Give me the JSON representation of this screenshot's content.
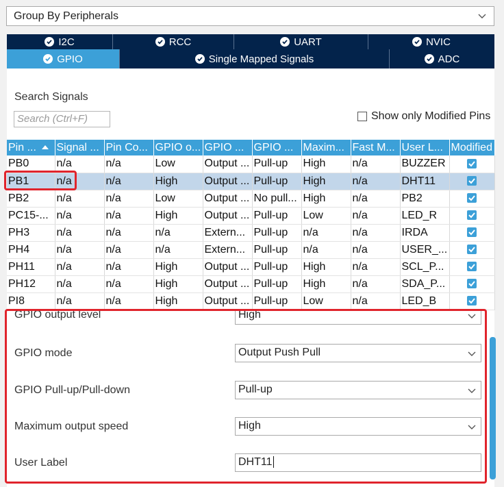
{
  "group_select": {
    "value": "Group By Peripherals",
    "icon": "chevron-down-icon"
  },
  "tabs_row1": [
    {
      "label": "I2C"
    },
    {
      "label": "RCC"
    },
    {
      "label": "UART"
    },
    {
      "label": "NVIC"
    }
  ],
  "tabs_row2": [
    {
      "label": "GPIO",
      "active": true
    },
    {
      "label": "Single Mapped Signals"
    },
    {
      "label": "ADC"
    }
  ],
  "search": {
    "label": "Search Signals",
    "placeholder": "Search (Ctrl+F)"
  },
  "show_modified": {
    "label": "Show only Modified Pins",
    "checked": false
  },
  "table": {
    "columns": [
      "Pin ...",
      "Signal ...",
      "Pin Co...",
      "GPIO o...",
      "GPIO ...",
      "GPIO ...",
      "Maxim...",
      "Fast M...",
      "User L...",
      "Modified"
    ],
    "rows": [
      [
        "PB0",
        "n/a",
        "n/a",
        "Low",
        "Output ...",
        "Pull-up",
        "High",
        "n/a",
        "BUZZER"
      ],
      [
        "PB1",
        "n/a",
        "n/a",
        "High",
        "Output ...",
        "Pull-up",
        "High",
        "n/a",
        "DHT11"
      ],
      [
        "PB2",
        "n/a",
        "n/a",
        "Low",
        "Output ...",
        "No pull...",
        "High",
        "n/a",
        "PB2"
      ],
      [
        "PC15-...",
        "n/a",
        "n/a",
        "High",
        "Output ...",
        "Pull-up",
        "Low",
        "n/a",
        "LED_R"
      ],
      [
        "PH3",
        "n/a",
        "n/a",
        "n/a",
        "Extern...",
        "Pull-up",
        "n/a",
        "n/a",
        "IRDA"
      ],
      [
        "PH4",
        "n/a",
        "n/a",
        "n/a",
        "Extern...",
        "Pull-up",
        "n/a",
        "n/a",
        "USER_..."
      ],
      [
        "PH11",
        "n/a",
        "n/a",
        "High",
        "Output ...",
        "Pull-up",
        "High",
        "n/a",
        "SCL_P..."
      ],
      [
        "PH12",
        "n/a",
        "n/a",
        "High",
        "Output ...",
        "Pull-up",
        "High",
        "n/a",
        "SDA_P..."
      ],
      [
        "PI8",
        "n/a",
        "n/a",
        "High",
        "Output ...",
        "Pull-up",
        "Low",
        "n/a",
        "LED_B"
      ]
    ],
    "selected_row": 1
  },
  "config": {
    "output_level": {
      "label": "GPIO output level",
      "value": "High"
    },
    "mode": {
      "label": "GPIO mode",
      "value": "Output Push Pull"
    },
    "pull": {
      "label": "GPIO Pull-up/Pull-down",
      "value": "Pull-up"
    },
    "speed": {
      "label": "Maximum output speed",
      "value": "High"
    },
    "user_label": {
      "label": "User Label",
      "value": "DHT11"
    }
  },
  "colors": {
    "accent": "#3ca0d8",
    "tab_dark": "#03234b",
    "highlight": "#e0242c",
    "selected_row": "#c2d6ea"
  }
}
